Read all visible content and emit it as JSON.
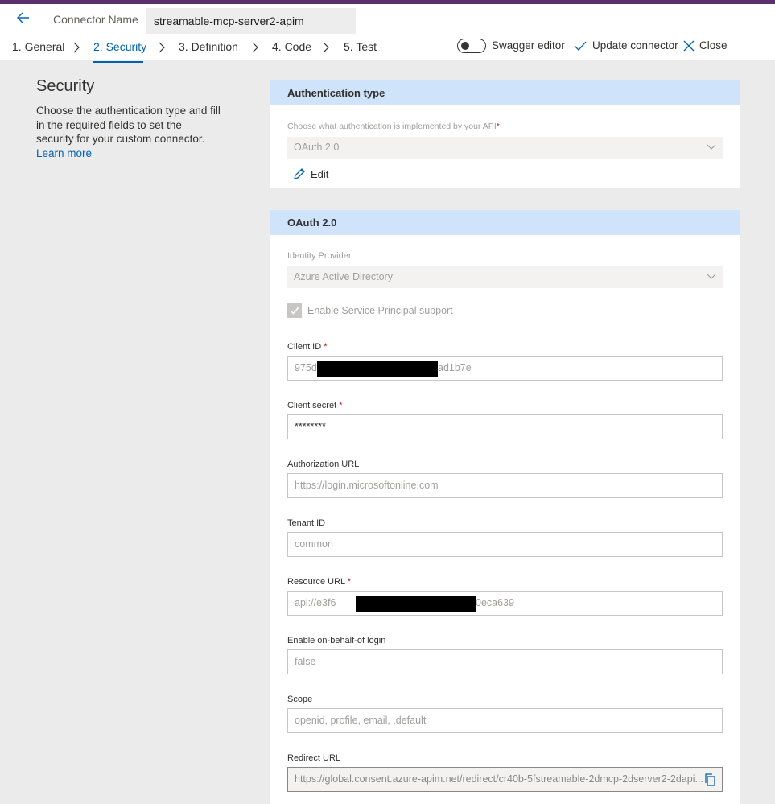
{
  "header": {
    "connector_name_label": "Connector Name",
    "connector_name_value": "streamable-mcp-server2-apim",
    "steps": [
      {
        "label": "1. General"
      },
      {
        "label": "2. Security"
      },
      {
        "label": "3. Definition"
      },
      {
        "label": "4. Code"
      },
      {
        "label": "5. Test"
      }
    ],
    "swagger_editor_label": "Swagger editor",
    "swagger_editor_on": false,
    "update_connector_label": "Update connector",
    "close_label": "Close",
    "accent_color": "#0063b1"
  },
  "left": {
    "title": "Security",
    "description": "Choose the authentication type and fill in the required fields to set the security for your custom connector.",
    "learn_more": "Learn more"
  },
  "auth_panel": {
    "title": "Authentication type",
    "prompt": "Choose what authentication is implemented by your API",
    "required_mark": "*",
    "selected": "OAuth 2.0",
    "edit_label": "Edit"
  },
  "oauth_panel": {
    "title": "OAuth 2.0",
    "identity_provider_label": "Identity Provider",
    "identity_provider_value": "Azure Active Directory",
    "service_principal_label": "Enable Service Principal support",
    "service_principal_checked": true,
    "client_id_label": "Client ID",
    "client_id_value_start": "975d",
    "client_id_value_end": "ad1b7e",
    "client_secret_label": "Client secret",
    "client_secret_value": "********",
    "authorization_url_label": "Authorization URL",
    "authorization_url_placeholder": "https://login.microsoftonline.com",
    "tenant_id_label": "Tenant ID",
    "tenant_id_placeholder": "common",
    "resource_url_label": "Resource URL",
    "resource_url_value_start": "api://e3f6",
    "resource_url_value_end": "0eca639",
    "obo_label": "Enable on-behalf-of login",
    "obo_placeholder": "false",
    "scope_label": "Scope",
    "scope_placeholder": "openid, profile, email, .default",
    "redirect_url_label": "Redirect URL",
    "redirect_url_value": "https://global.consent.azure-apim.net/redirect/cr40b-5fstreamable-2dmcp-2dserver2-2dapi..."
  }
}
